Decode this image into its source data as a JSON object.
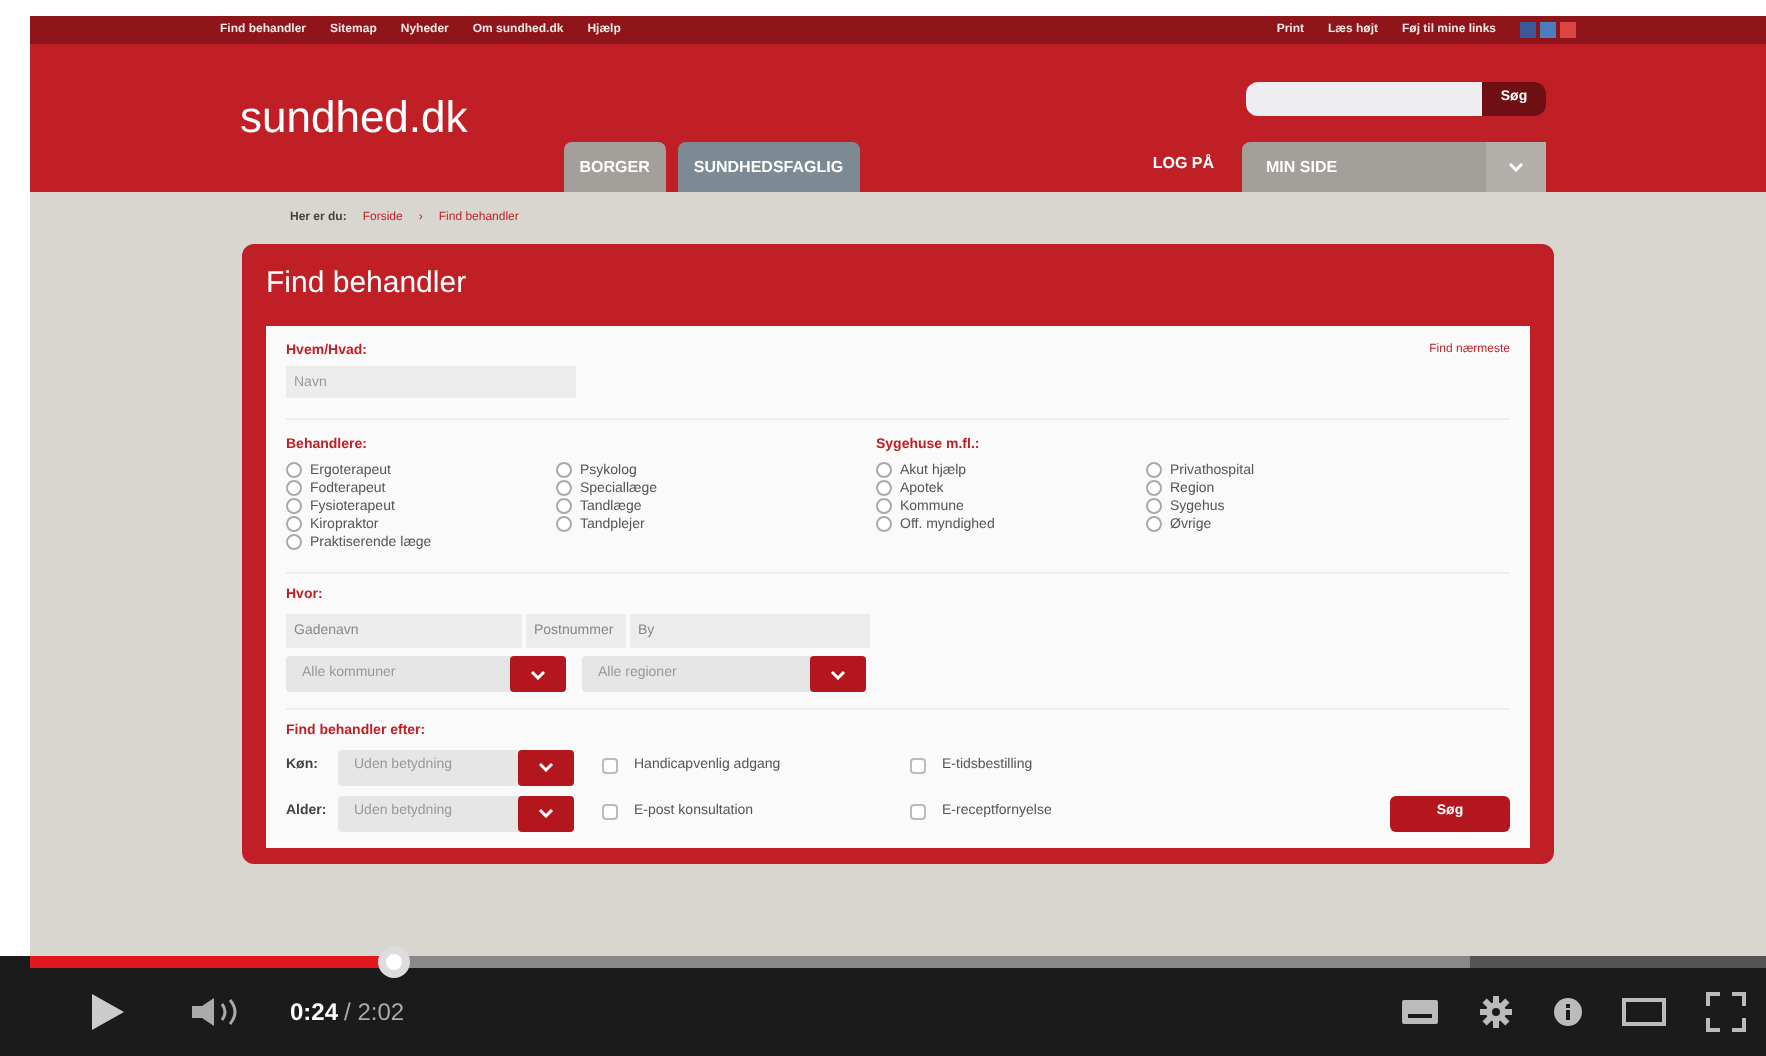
{
  "site": {
    "top_links": [
      "Find behandler",
      "Sitemap",
      "Nyheder",
      "Om sundhed.dk",
      "Hjælp"
    ],
    "top_right_links": [
      "Print",
      "Læs højt",
      "Føj til mine links"
    ],
    "logo": "sundhed.dk",
    "search_button": "Søg",
    "tabs": [
      {
        "label": "BORGER",
        "selected": true
      },
      {
        "label": "SUNDHEDSFAGLIG",
        "selected": false
      }
    ],
    "login": "LOG PÅ",
    "my_page": "MIN SIDE",
    "breadcrumb": {
      "prefix": "Her er du:",
      "items": [
        "Forside",
        "Find behandler"
      ],
      "separator": "›"
    },
    "form": {
      "title": "Find behandler",
      "nearest_link": "Find nærmeste",
      "who_label": "Hvem/Hvad:",
      "who_field": {
        "placeholder": "Navn"
      },
      "groups": [
        {
          "label": "Behandlere:",
          "columns": [
            [
              {
                "label": "Ergoterapeut",
                "checked": false
              },
              {
                "label": "Fodterapeut",
                "checked": false
              },
              {
                "label": "Fysioterapeut",
                "checked": false
              },
              {
                "label": "Kiropraktor",
                "checked": false
              },
              {
                "label": "Praktiserende læge",
                "checked": false
              }
            ],
            [
              {
                "label": "Psykolog",
                "checked": false
              },
              {
                "label": "Speciallæge",
                "checked": false
              },
              {
                "label": "Tandlæge",
                "checked": false
              },
              {
                "label": "Tandplejer",
                "checked": false
              }
            ]
          ]
        },
        {
          "label": "Sygehuse m.fl.:",
          "columns": [
            [
              {
                "label": "Akut hjælp",
                "checked": false
              },
              {
                "label": "Apotek",
                "checked": false
              },
              {
                "label": "Kommune",
                "checked": false
              },
              {
                "label": "Off. myndighed",
                "checked": false
              }
            ],
            [
              {
                "label": "Privathospital",
                "checked": false
              },
              {
                "label": "Region",
                "checked": false
              },
              {
                "label": "Sygehus",
                "checked": false
              },
              {
                "label": "Øvrige",
                "checked": false
              }
            ]
          ]
        }
      ],
      "where_label": "Hvor:",
      "street": {
        "placeholder": "Gadenavn"
      },
      "postcode": {
        "placeholder": "Postnummer"
      },
      "city": {
        "placeholder": "By"
      },
      "selects": [
        {
          "value": "Alle kommuner"
        },
        {
          "value": "Alle regioner"
        }
      ],
      "filter_label": "Find behandler efter:",
      "filters": [
        {
          "label": "Køn:",
          "value": "Uden betydning"
        },
        {
          "label": "Alder:",
          "value": "Uden betydning"
        }
      ],
      "options": [
        [
          {
            "label": "Handicapvenlig adgang",
            "checked": false
          },
          {
            "label": "E-post konsultation",
            "checked": false
          }
        ],
        [
          {
            "label": "E-tidsbestilling",
            "checked": false
          },
          {
            "label": "E-receptfornyelse",
            "checked": false
          }
        ]
      ],
      "submit": "Søg"
    }
  },
  "player": {
    "progress": {
      "level": 0.21
    },
    "buffered": {
      "level": 0.83
    },
    "current_time": "0:24",
    "duration": "/ 2:02"
  }
}
